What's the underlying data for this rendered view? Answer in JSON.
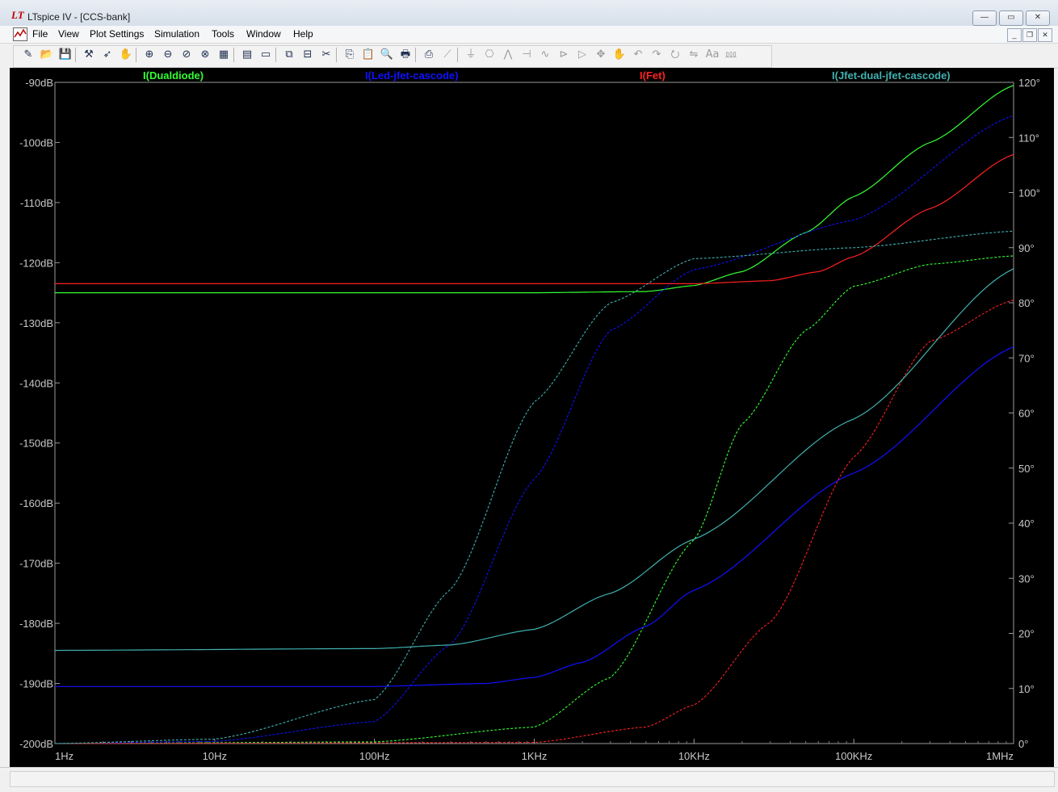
{
  "window": {
    "title": "LTspice IV - [CCS-bank]",
    "app_icon": "ltspice-logo-icon",
    "controls": [
      "minimize-icon",
      "maximize-icon",
      "close-icon"
    ]
  },
  "menubar": {
    "items": [
      "File",
      "View",
      "Plot Settings",
      "Simulation",
      "Tools",
      "Window",
      "Help"
    ]
  },
  "toolbar": {
    "icons": [
      "new-schematic-icon",
      "open-icon",
      "save-icon",
      "control-panel-icon",
      "run-icon",
      "halt-icon",
      "zoom-in-icon",
      "zoom-out-icon",
      "zoom-back-icon",
      "zoom-fit-icon",
      "autorange-icon",
      "visible-traces-icon",
      "tile-horizontal-icon",
      "cascade-icon",
      "tile-vertical-icon",
      "cut-icon",
      "copy-icon",
      "paste-icon",
      "find-icon",
      "print-preview-icon",
      "print-icon",
      "wire-icon",
      "ground-icon",
      "label-icon",
      "resistor-icon",
      "capacitor-icon",
      "inductor-icon",
      "diode-icon",
      "component-icon",
      "move-icon",
      "drag-icon",
      "undo-icon",
      "redo-icon",
      "rotate-icon",
      "mirror-icon",
      "text-icon",
      "spice-directive-icon"
    ]
  },
  "chart_data": {
    "type": "line",
    "background": "#000000",
    "x_axis": {
      "scale": "log",
      "range": [
        1,
        1000000
      ],
      "tick_labels": [
        "1Hz",
        "10Hz",
        "100Hz",
        "1KHz",
        "10KHz",
        "100KHz",
        "1MHz"
      ]
    },
    "y_left": {
      "unit": "dB",
      "range": [
        -200,
        -90
      ],
      "tick_labels": [
        "-90dB",
        "-100dB",
        "-110dB",
        "-120dB",
        "-130dB",
        "-140dB",
        "-150dB",
        "-160dB",
        "-170dB",
        "-180dB",
        "-190dB",
        "-200dB"
      ]
    },
    "y_right": {
      "unit": "degrees",
      "range": [
        0,
        120
      ],
      "tick_labels": [
        "120°",
        "110°",
        "100°",
        "90°",
        "80°",
        "70°",
        "60°",
        "50°",
        "40°",
        "30°",
        "20°",
        "10°",
        "0°"
      ]
    },
    "series": [
      {
        "name": "I(Dualdiode)",
        "color": "#33ff33",
        "magnitude_db": [
          [
            1,
            -125
          ],
          [
            1000,
            -125
          ],
          [
            5000,
            -124.8
          ],
          [
            10000,
            -123.8
          ],
          [
            20000,
            -121.5
          ],
          [
            50000,
            -115
          ],
          [
            100000,
            -109
          ],
          [
            300000,
            -100
          ],
          [
            1000000,
            -90.5
          ]
        ],
        "phase_deg": [
          [
            1,
            0
          ],
          [
            100,
            0.3
          ],
          [
            1000,
            3
          ],
          [
            3000,
            12
          ],
          [
            10000,
            37
          ],
          [
            20000,
            58
          ],
          [
            50000,
            75
          ],
          [
            100000,
            83
          ],
          [
            300000,
            87
          ],
          [
            1000000,
            88.5
          ]
        ]
      },
      {
        "name": "I(Led-jfet-cascode)",
        "color": "#1010ff",
        "magnitude_db": [
          [
            1,
            -190.5
          ],
          [
            100,
            -190.5
          ],
          [
            500,
            -190
          ],
          [
            1000,
            -189
          ],
          [
            2000,
            -186.5
          ],
          [
            5000,
            -180.5
          ],
          [
            10000,
            -174.5
          ],
          [
            100000,
            -155
          ],
          [
            1000000,
            -134
          ]
        ],
        "phase_deg": [
          [
            1,
            0
          ],
          [
            10,
            0.4
          ],
          [
            100,
            4
          ],
          [
            300,
            18
          ],
          [
            1000,
            48
          ],
          [
            3000,
            75
          ],
          [
            10000,
            86
          ],
          [
            100000,
            95
          ],
          [
            1000000,
            114
          ]
        ]
      },
      {
        "name": "I(Fet)",
        "color": "#ff2020",
        "magnitude_db": [
          [
            1,
            -123.5
          ],
          [
            10000,
            -123.5
          ],
          [
            30000,
            -123
          ],
          [
            60000,
            -121.5
          ],
          [
            100000,
            -119
          ],
          [
            300000,
            -111
          ],
          [
            1000000,
            -102
          ]
        ],
        "phase_deg": [
          [
            1,
            0
          ],
          [
            1000,
            0.2
          ],
          [
            5000,
            3
          ],
          [
            10000,
            7
          ],
          [
            30000,
            22
          ],
          [
            100000,
            52
          ],
          [
            300000,
            73
          ],
          [
            1000000,
            80.5
          ]
        ]
      },
      {
        "name": "I(Jfet-dual-jfet-cascode)",
        "color": "#40b0b0",
        "magnitude_db": [
          [
            1,
            -184.5
          ],
          [
            100,
            -184.2
          ],
          [
            300,
            -183.6
          ],
          [
            1000,
            -181
          ],
          [
            3000,
            -175
          ],
          [
            10000,
            -166
          ],
          [
            100000,
            -146
          ],
          [
            1000000,
            -121
          ]
        ],
        "phase_deg": [
          [
            1,
            0
          ],
          [
            10,
            0.8
          ],
          [
            100,
            8
          ],
          [
            300,
            28
          ],
          [
            1000,
            62
          ],
          [
            3000,
            80
          ],
          [
            10000,
            88
          ],
          [
            100000,
            90
          ],
          [
            1000000,
            93
          ]
        ]
      }
    ],
    "legend_placement": "top"
  }
}
